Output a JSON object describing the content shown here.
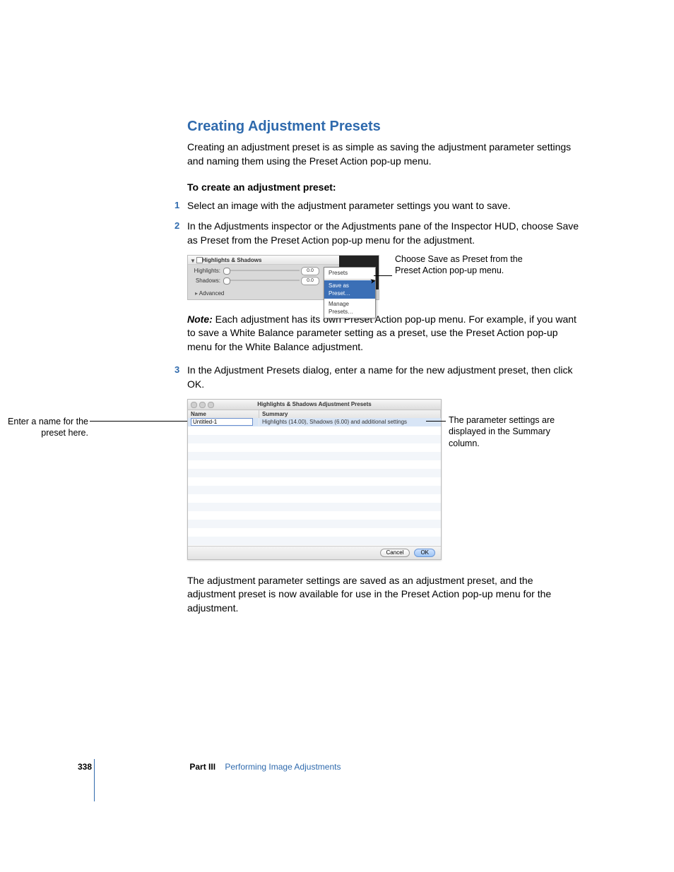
{
  "heading": "Creating Adjustment Presets",
  "intro": "Creating an adjustment preset is as simple as saving the adjustment parameter settings and naming them using the Preset Action pop-up menu.",
  "subhead": "To create an adjustment preset:",
  "steps": {
    "s1": "Select an image with the adjustment parameter settings you want to save.",
    "s2": "In the Adjustments inspector or the Adjustments pane of the Inspector HUD, choose Save as Preset from the Preset Action pop-up menu for the adjustment.",
    "s3": "In the Adjustment Presets dialog, enter a name for the new adjustment preset, then click OK."
  },
  "shot1": {
    "panel_title": "Highlights & Shadows",
    "row_highlights": "Highlights:",
    "row_shadows": "Shadows:",
    "val": "0.0",
    "advanced": "Advanced",
    "menu_presets": "Presets",
    "menu_save": "Save as Preset…",
    "menu_manage": "Manage Presets…"
  },
  "callout1": "Choose Save as Preset from the Preset Action pop-up menu.",
  "note_label": "Note:",
  "note_body": "  Each adjustment has its own Preset Action pop-up menu. For example, if you want to save a White Balance parameter setting as a preset, use the Preset Action pop-up menu for the White Balance adjustment.",
  "shot2": {
    "title": "Highlights & Shadows Adjustment Presets",
    "col_name": "Name",
    "col_summary": "Summary",
    "row_name": "Untitled-1",
    "row_summary": "Highlights (14.00), Shadows (6.00) and additional settings",
    "btn_cancel": "Cancel",
    "btn_ok": "OK"
  },
  "callout_left": "Enter a name for the preset here.",
  "callout_right": "The parameter settings are displayed in the Summary column.",
  "after": "The adjustment parameter settings are saved as an adjustment preset, and the adjustment preset is now available for use in the Preset Action pop-up menu for the adjustment.",
  "footer": {
    "pageno": "338",
    "part": "Part III",
    "partname": "Performing Image Adjustments"
  }
}
